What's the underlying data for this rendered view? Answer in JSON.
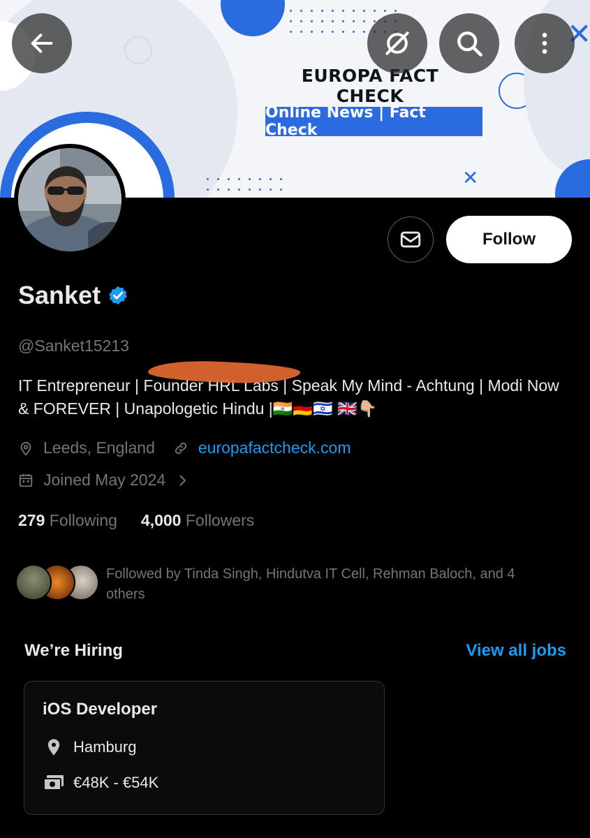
{
  "banner": {
    "title": "EUROPA FACT CHECK",
    "tagline": "Online News | Fact Check",
    "accent": "#2b6be0"
  },
  "top_bar": {
    "back_icon": "arrow-left-icon",
    "grok_icon": "slash-circle-icon",
    "search_icon": "search-icon",
    "more_icon": "more-vertical-icon"
  },
  "actions": {
    "message_icon": "envelope-icon",
    "follow_label": "Follow"
  },
  "profile": {
    "name": "Sanket",
    "verified_icon": "verified-badge-icon",
    "handle": "@Sanket15213",
    "bio": "IT Entrepreneur | Founder HRL Labs | Speak My Mind - Achtung | Modi Now & FOREVER | Unapologetic Hindu |🇮🇳🇩🇪🇮🇱 🇬🇧👇🏼",
    "location": "Leeds, England",
    "website": "europafactcheck.com",
    "joined": "Joined May 2024"
  },
  "stats": {
    "following_count": "279",
    "following_label": "Following",
    "followers_count": "4,000",
    "followers_label": "Followers"
  },
  "followed_by": "Followed by Tinda Singh, Hindutva IT Cell, Rehman Baloch, and 4 others",
  "hiring": {
    "title": "We’re Hiring",
    "view_all": "View all jobs",
    "job": {
      "title": "iOS Developer",
      "location": "Hamburg",
      "salary": "€48K - €54K"
    }
  },
  "colors": {
    "background": "#000000",
    "text_primary": "#e7e9ea",
    "text_secondary": "#71767b",
    "link": "#1d9bf0",
    "redaction": "#e26830"
  }
}
